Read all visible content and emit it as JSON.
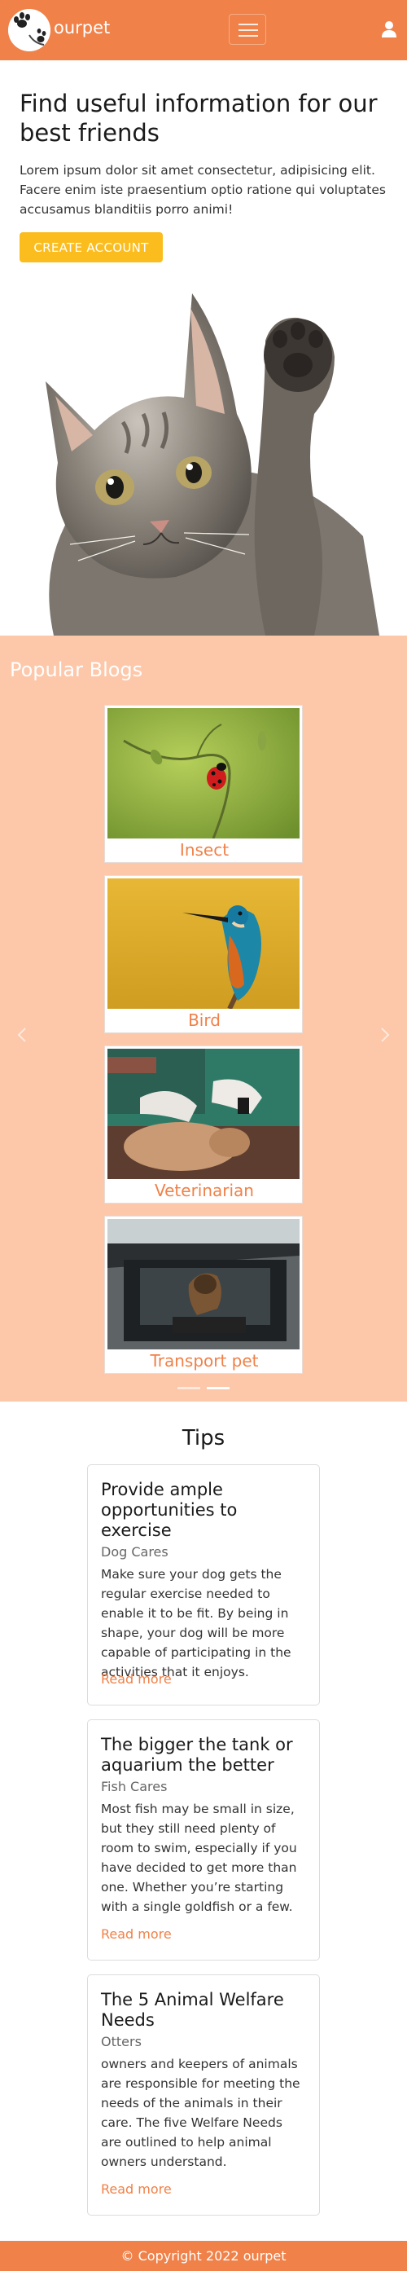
{
  "navbar": {
    "brand": "ourpet",
    "menu_icon": "hamburger-icon",
    "user_icon": "user-icon",
    "accent_color": "#f08148"
  },
  "hero": {
    "title": "Find useful information for our best friends",
    "text": "Lorem ipsum dolor sit amet consectetur, adipisicing elit. Facere enim iste praesentium optio ratione qui voluptates accusamus blanditiis porro animi!",
    "cta_label": "CREATE ACCOUNT",
    "cta_color": "#fbbd1e"
  },
  "blogs": {
    "title": "Popular Blogs",
    "background": "#fdc7a9",
    "items": [
      {
        "label": "Insect"
      },
      {
        "label": "Bird"
      },
      {
        "label": "Veterinarian"
      },
      {
        "label": "Transport pet"
      }
    ]
  },
  "tips": {
    "title": "Tips",
    "items": [
      {
        "title": "Provide ample opportunities to exercise",
        "subtitle": "Dog Cares",
        "text": "Make sure your dog gets the regular exercise needed to enable it to be fit. By being in shape, your dog will be more capable of participating in the activities that it enjoys.",
        "link": "Read more"
      },
      {
        "title": "The bigger the tank or aquarium the better",
        "subtitle": "Fish Cares",
        "text": "Most fish may be small in size, but they still need plenty of room to swim, especially if you have decided to get more than one. Whether you’re starting with a single goldfish or a few.",
        "link": "Read more"
      },
      {
        "title": "The 5 Animal Welfare Needs",
        "subtitle": "Otters",
        "text": "owners and keepers of animals are responsible for meeting the needs of the animals in their care. The five Welfare Needs are outlined to help animal owners understand.",
        "link": "Read more"
      }
    ]
  },
  "footer": {
    "text": "© Copyright 2022 ourpet"
  }
}
